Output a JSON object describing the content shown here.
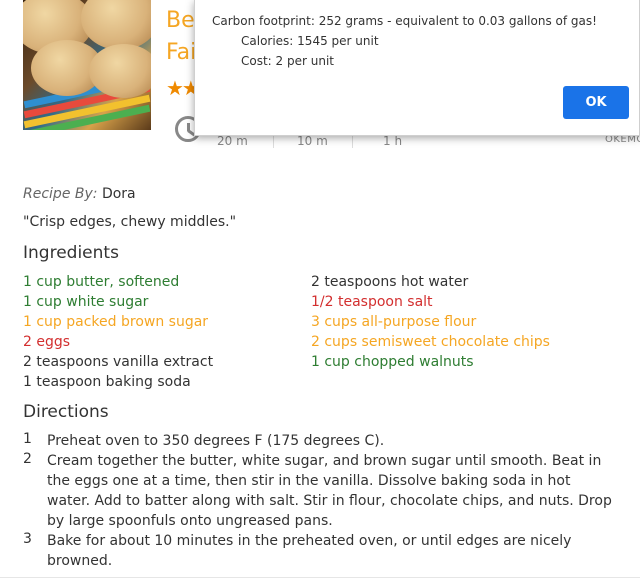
{
  "recipe": {
    "title_line1": "Be",
    "title_line2": "Fai",
    "stars": "★★",
    "times": {
      "prep": "20 m",
      "cook": "10 m",
      "ready": "1 h"
    },
    "brand": "OKEMC",
    "byline_label": "Recipe By:",
    "author": "Dora",
    "quote": "\"Crisp edges, chewy middles.\"",
    "ingredients_heading": "Ingredients",
    "ingredients_left": [
      {
        "text": "1 cup butter, softened",
        "color": "#2e7d32"
      },
      {
        "text": "1 cup white sugar",
        "color": "#2e7d32"
      },
      {
        "text": "1 cup packed brown sugar",
        "color": "#f5a623"
      },
      {
        "text": "2 eggs",
        "color": "#d32f2f"
      },
      {
        "text": "2 teaspoons vanilla extract",
        "color": "#333333"
      },
      {
        "text": "1 teaspoon baking soda",
        "color": "#333333"
      }
    ],
    "ingredients_right": [
      {
        "text": "2 teaspoons hot water",
        "color": "#333333"
      },
      {
        "text": "1/2 teaspoon salt",
        "color": "#d32f2f"
      },
      {
        "text": "3 cups all-purpose flour",
        "color": "#f5a623"
      },
      {
        "text": "2 cups semisweet chocolate chips",
        "color": "#f5a623"
      },
      {
        "text": "1 cup chopped walnuts",
        "color": "#2e7d32"
      }
    ],
    "directions_heading": "Directions",
    "directions": [
      {
        "num": "1",
        "text": "Preheat oven to 350 degrees F (175 degrees C)."
      },
      {
        "num": "2",
        "text": "Cream together the butter, white sugar, and brown sugar until smooth. Beat in the eggs one at a time, then stir in the vanilla. Dissolve baking soda in hot water. Add to batter along with salt. Stir in flour, chocolate chips, and nuts. Drop by large spoonfuls onto ungreased pans."
      },
      {
        "num": "3",
        "text": "Bake for about 10 minutes in the preheated oven, or until edges are nicely browned."
      }
    ]
  },
  "dialog": {
    "line1": "Carbon footprint: 252 grams - equivalent to 0.03 gallons of gas!",
    "line2": "Calories: 1545 per unit",
    "line3": "Cost: 2 per unit",
    "ok_label": "OK"
  },
  "colors": {
    "green": "#2e7d32",
    "orange": "#f5a623",
    "red": "#d32f2f",
    "button_blue": "#1a73e8"
  }
}
